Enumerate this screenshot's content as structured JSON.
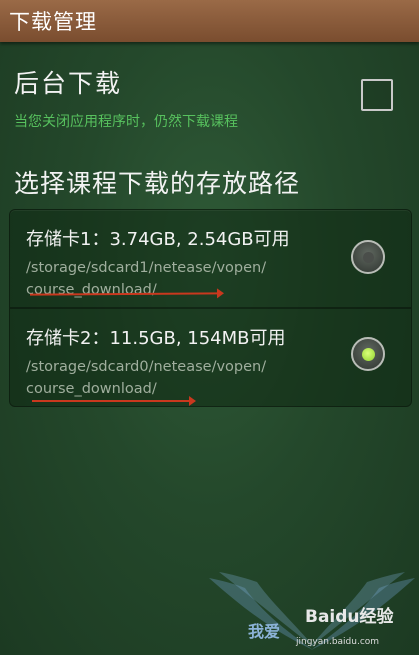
{
  "titlebar": {
    "title": "下载管理"
  },
  "background_download": {
    "title": "后台下载",
    "subtitle": "当您关闭应用程序时，仍然下载课程",
    "checked": false
  },
  "storage": {
    "section_title": "选择课程下载的存放路径",
    "options": [
      {
        "label": "存储卡1：3.74GB, 2.54GB可用",
        "path_line1": "/storage/sdcard1/netease/vopen/",
        "path_line2": "course_download/",
        "selected": false
      },
      {
        "label": "存储卡2：11.5GB, 154MB可用",
        "path_line1": "/storage/sdcard0/netease/vopen/",
        "path_line2": "course_download/",
        "selected": true
      }
    ]
  },
  "watermark": {
    "brand": "Baidu经验",
    "url": "jingyan.baidu.com",
    "cn": "我爱"
  },
  "colors": {
    "titlebar": "#8a5b3b",
    "background": "#2a4f31",
    "accent_green": "#57c15e",
    "annotation_arrow": "#c9381e"
  }
}
